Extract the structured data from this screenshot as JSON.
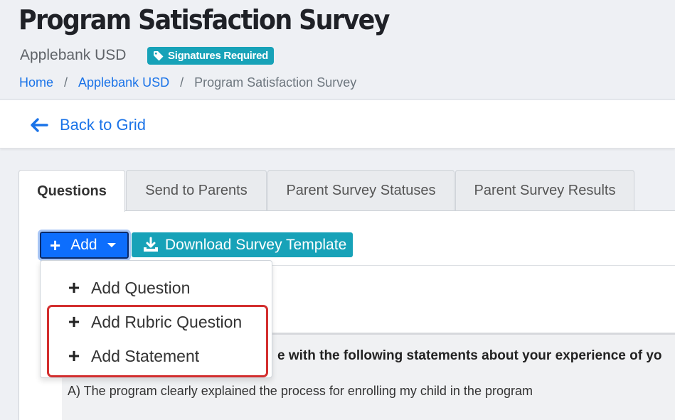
{
  "header": {
    "title": "Program Satisfaction Survey",
    "org": "Applebank USD",
    "badge": "Signatures Required",
    "badge_icon": "tag-icon",
    "breadcrumb": {
      "home": "Home",
      "sep": "/",
      "org": "Applebank USD",
      "current": "Program Satisfaction Survey"
    }
  },
  "backbar": {
    "label": "Back to Grid",
    "icon": "arrow-left-icon"
  },
  "tabs": [
    {
      "label": "Questions",
      "active": true
    },
    {
      "label": "Send to Parents",
      "active": false
    },
    {
      "label": "Parent Survey Statuses",
      "active": false
    },
    {
      "label": "Parent Survey Results",
      "active": false
    }
  ],
  "toolbar": {
    "add_label": "Add",
    "download_label": "Download Survey Template"
  },
  "add_menu": [
    {
      "label": "Add Question"
    },
    {
      "label": "Add Rubric Question"
    },
    {
      "label": "Add Statement"
    }
  ],
  "question": {
    "header_visible_text": "e with the following statements about your experience of yo",
    "row_text": "A) The program clearly explained the process for enrolling my child in the program"
  },
  "colors": {
    "primary": "#0d6efd",
    "info": "#17a2b8",
    "link": "#1a73e8",
    "highlight": "#d32f2f"
  }
}
